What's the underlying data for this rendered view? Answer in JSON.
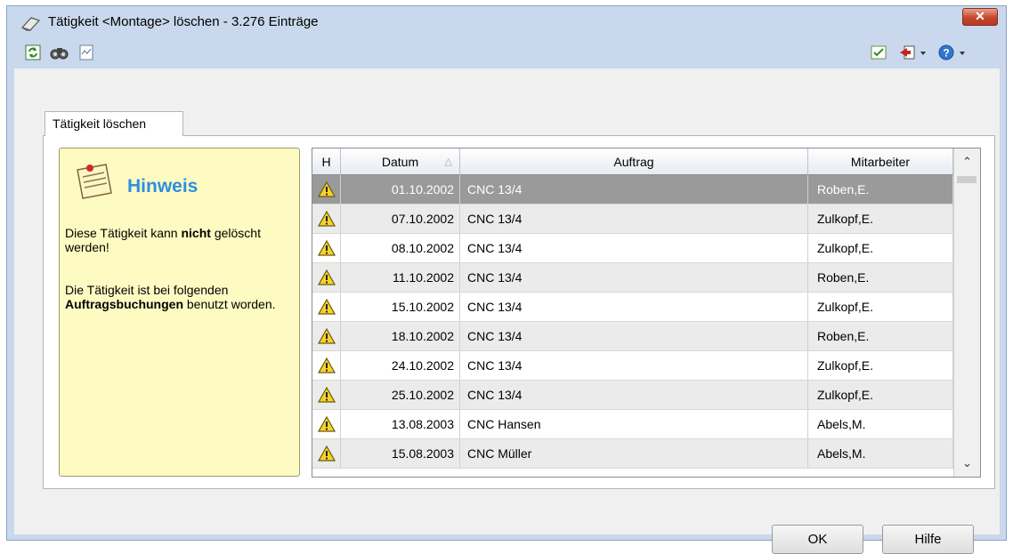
{
  "window": {
    "title": "Tätigkeit <Montage> löschen - 3.276 Einträge",
    "close_glyph": "✕"
  },
  "toolbar": {
    "left_icons": [
      "refresh-icon",
      "binoculars-icon",
      "report-icon"
    ],
    "right_icons": [
      "checklist-icon",
      "exit-icon",
      "help-icon"
    ]
  },
  "tab": {
    "label": "Tätigkeit löschen"
  },
  "hint": {
    "title": "Hinweis",
    "p1_pre": "Diese Tätigkeit kann ",
    "p1_bold": "nicht",
    "p1_post": " gelöscht werden!",
    "p2_pre": "Die Tätigkeit ist bei folgenden ",
    "p2_bold": "Auftragsbuchungen",
    "p2_post": " benutzt worden."
  },
  "grid": {
    "columns": {
      "h": "H",
      "datum": "Datum",
      "auftrag": "Auftrag",
      "mitarbeiter": "Mitarbeiter"
    },
    "sort_glyph": "△",
    "rows": [
      {
        "datum": "01.10.2002",
        "auftrag": "CNC 13/4",
        "mitarbeiter": "Roben,E."
      },
      {
        "datum": "07.10.2002",
        "auftrag": "CNC 13/4",
        "mitarbeiter": "Zulkopf,E."
      },
      {
        "datum": "08.10.2002",
        "auftrag": "CNC 13/4",
        "mitarbeiter": "Zulkopf,E."
      },
      {
        "datum": "11.10.2002",
        "auftrag": "CNC 13/4",
        "mitarbeiter": "Roben,E."
      },
      {
        "datum": "15.10.2002",
        "auftrag": "CNC 13/4",
        "mitarbeiter": "Zulkopf,E."
      },
      {
        "datum": "18.10.2002",
        "auftrag": "CNC 13/4",
        "mitarbeiter": "Roben,E."
      },
      {
        "datum": "24.10.2002",
        "auftrag": "CNC 13/4",
        "mitarbeiter": "Zulkopf,E."
      },
      {
        "datum": "25.10.2002",
        "auftrag": "CNC 13/4",
        "mitarbeiter": "Zulkopf,E."
      },
      {
        "datum": "13.08.2003",
        "auftrag": "CNC Hansen",
        "mitarbeiter": "Abels,M."
      },
      {
        "datum": "15.08.2003",
        "auftrag": "CNC Müller",
        "mitarbeiter": "Abels,M."
      }
    ],
    "scroll_up": "⌃",
    "scroll_down": "⌄"
  },
  "buttons": {
    "ok": "OK",
    "help": "Hilfe"
  }
}
